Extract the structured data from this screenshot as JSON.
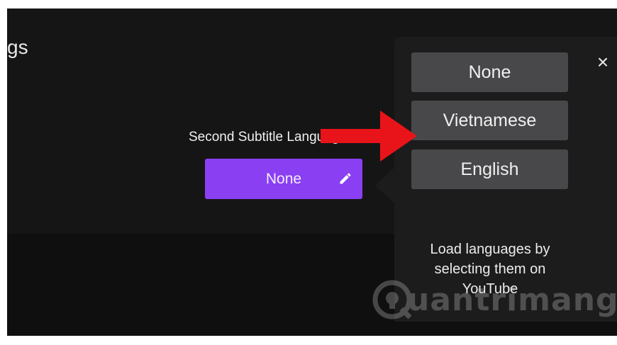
{
  "page": {
    "title_fragment": "gs"
  },
  "setting": {
    "label": "Second Subtitle Language",
    "value": "None",
    "edit_icon": "pencil-icon",
    "accent_color": "#8a3ff2"
  },
  "popup": {
    "close_icon": "close-icon",
    "close_glyph": "×",
    "options": [
      "None",
      "Vietnamese",
      "English"
    ],
    "hint": "Load languages by selecting them on YouTube"
  },
  "annotation": {
    "arrow_icon": "red-arrow-icon",
    "arrow_color": "#e8141a"
  },
  "watermark": {
    "text": "uantrimang",
    "logo_icon": "lightbulb-q-icon"
  }
}
